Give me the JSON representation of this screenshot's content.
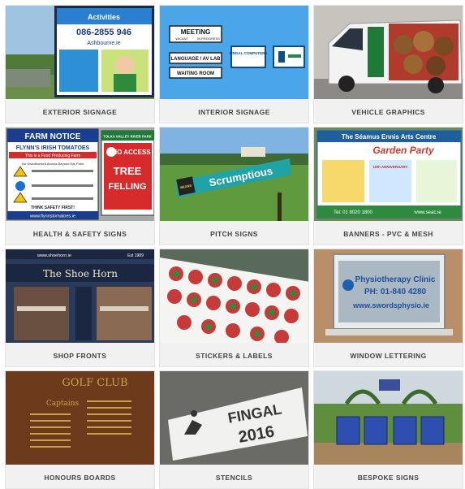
{
  "tiles": [
    {
      "caption": "EXTERIOR SIGNAGE",
      "photo_text": {
        "phone": "086-2855 946",
        "web": "Ashbourne.ie",
        "brand": "Activities"
      }
    },
    {
      "caption": "INTERIOR SIGNAGE",
      "photo_text": {
        "meeting": "MEETING",
        "vacant": "VACANT",
        "in_progress": "IN PROGRESS",
        "lab": "LANGUAGE / AV LAB",
        "waiting": "WAITING ROOM",
        "fingal": "FINGAL COMPUTERS"
      }
    },
    {
      "caption": "VEHICLE GRAPHICS",
      "photo_text": {}
    },
    {
      "caption": "HEALTH & SAFETY SIGNS",
      "photo_text": {
        "farm_notice": "FARM NOTICE",
        "flynns": "FLYNN'S IRISH TOMATOES",
        "line1": "This is a Food Producing Farm",
        "no_unauth": "No Unauthorised Access Beyond this Point",
        "think": "THINK SAFETY FIRST!",
        "web": "www.flynnstomatoes.ie",
        "park": "TOLKA VALLEY RIVER PARK",
        "no_access": "NO ACCESS",
        "tree": "TREE",
        "felling": "FELLING"
      }
    },
    {
      "caption": "PITCH SIGNS",
      "photo_text": {
        "brand": "Scrumptious",
        "small": "BEANS"
      }
    },
    {
      "caption": "BANNERS - PVC & MESH",
      "photo_text": {
        "title": "The Séamus Ennis Arts Centre",
        "sub": "Garden Party",
        "tel": "Tel: 01 8020 1800",
        "web": "www.seac.ie",
        "anniv": "10th ANNIVERSARY"
      }
    },
    {
      "caption": "SHOP FRONTS",
      "photo_text": {
        "url": "www.shoehorn.ie",
        "est": "Est 1989",
        "name": "The Shoe Horn"
      }
    },
    {
      "caption": "STICKERS & LABELS",
      "photo_text": {}
    },
    {
      "caption": "WINDOW LETTERING",
      "photo_text": {
        "clinic": "Physiotherapy Clinic",
        "ph": "PH: 01-840 4280",
        "web": "www.swordsphysio.ie"
      }
    },
    {
      "caption": "HONOURS BOARDS",
      "photo_text": {
        "club": "GOLF CLUB",
        "captains": "Captains"
      }
    },
    {
      "caption": "STENCILS",
      "photo_text": {
        "word": "FINGAL",
        "year": "2016"
      }
    },
    {
      "caption": "BESPOKE SIGNS",
      "photo_text": {}
    }
  ]
}
